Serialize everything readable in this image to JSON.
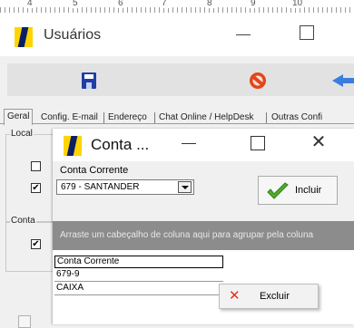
{
  "ruler": {
    "numbers": [
      "4",
      "5",
      "6",
      "7",
      "8",
      "9",
      "10"
    ]
  },
  "main_window": {
    "title": "Usuários",
    "tabs": [
      "Geral",
      "Config. E-mail",
      "Endereço",
      "Chat Online / HelpDesk",
      "Outras Confi"
    ],
    "groups": {
      "local": "Local",
      "conta": "Conta"
    },
    "checkbox_mark": "✔"
  },
  "dialog": {
    "title": "Conta ...",
    "close_glyph": "✕",
    "conta_corrente_label": "Conta Corrente",
    "conta_corrente_value": "679 - SANTANDER",
    "incluir_label": "Incluir",
    "group_panel_text": "Arraste um cabeçalho de coluna aqui para agrupar pela coluna",
    "grid": {
      "header": "Conta Corrente",
      "rows": [
        "679-9",
        "CAIXA"
      ]
    }
  },
  "context_menu": {
    "excluir_label": "Excluir",
    "icon_glyph": "✕"
  },
  "colors": {
    "accent_blue": "#1f3fa6",
    "danger": "#e0341e",
    "ok_green": "#4fae2a",
    "logo_yellow": "#ffd400"
  }
}
